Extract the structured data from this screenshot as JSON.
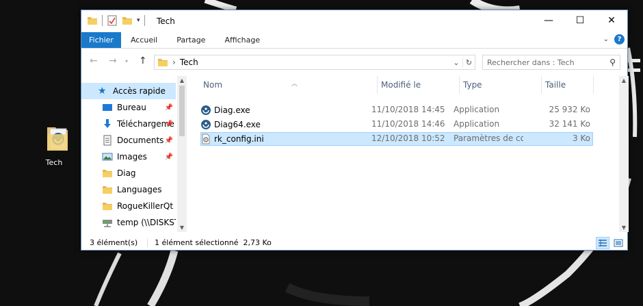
{
  "desktop": {
    "icon_label": "Tech"
  },
  "window": {
    "title": "Tech",
    "accent": "#1979ca",
    "ribbon": {
      "tabs": [
        "Fichier",
        "Accueil",
        "Partage",
        "Affichage"
      ]
    },
    "address": {
      "breadcrumb_sep": "›",
      "path": "Tech"
    },
    "search": {
      "placeholder": "Rechercher dans : Tech"
    },
    "nav": {
      "items": [
        {
          "label": "Accès rapide",
          "icon": "star-icon",
          "pinned": false,
          "selected": true
        },
        {
          "label": "Bureau",
          "icon": "desktop-icon",
          "pinned": true
        },
        {
          "label": "Téléchargements",
          "icon": "download-icon",
          "pinned": true
        },
        {
          "label": "Documents",
          "icon": "document-icon",
          "pinned": true
        },
        {
          "label": "Images",
          "icon": "picture-icon",
          "pinned": true
        },
        {
          "label": "Diag",
          "icon": "folder-icon",
          "pinned": false
        },
        {
          "label": "Languages",
          "icon": "folder-icon",
          "pinned": false
        },
        {
          "label": "RogueKillerQt",
          "icon": "folder-icon",
          "pinned": false
        },
        {
          "label": "temp (\\\\DISKSTATION",
          "icon": "network-drive-icon",
          "pinned": false
        }
      ]
    },
    "columns": {
      "name": "Nom",
      "modified": "Modifié le",
      "type": "Type",
      "size": "Taille"
    },
    "files": [
      {
        "name": "Diag.exe",
        "modified": "11/10/2018 14:45",
        "type": "Application",
        "size": "25 932 Ko",
        "icon": "exe-icon",
        "selected": false
      },
      {
        "name": "Diag64.exe",
        "modified": "11/10/2018 14:46",
        "type": "Application",
        "size": "32 141 Ko",
        "icon": "exe-icon",
        "selected": false
      },
      {
        "name": "rk_config.ini",
        "modified": "12/10/2018 10:52",
        "type": "Paramètres de configuration",
        "size": "3 Ko",
        "icon": "ini-file-icon",
        "selected": true
      }
    ],
    "status": {
      "count": "3 élément(s)",
      "selection": "1 élément sélectionné  2,73 Ko"
    }
  }
}
